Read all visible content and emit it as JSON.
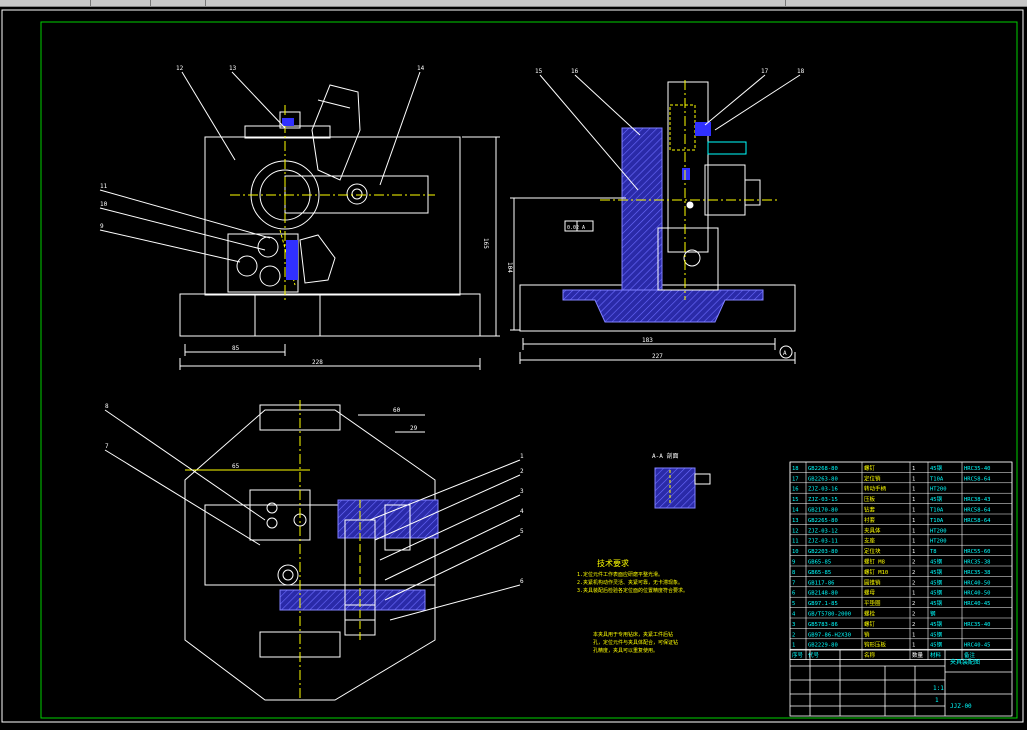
{
  "toolbar": {
    "tabs": [
      "",
      "",
      "",
      "",
      ""
    ]
  },
  "drawing": {
    "section_label": "A-A 剖面",
    "tech_title": "技术要求",
    "tech_notes": [
      "1.定位元件工作表面应研磨平整光滑。",
      "2.夹紧机构动作灵活、夹紧可靠，无卡滞现象。",
      "3.夹具装配后检验各定位面的位置精度符合要求。"
    ],
    "note_body": [
      "本夹具用于专用钻床，夹紧工件后钻",
      "孔，定位元件与夹具体配合，可保证钻",
      "孔精度，夹具可以重复使用。"
    ],
    "dimensions": {
      "w_front": "228",
      "w_front_part": "85",
      "h_front": "165",
      "w_side": "227",
      "w_side_part": "183",
      "h_side": "104",
      "top_view_1": "65",
      "top_view_2": "60",
      "top_view_3": "29",
      "tol_frame": "0.02 A",
      "datum": "A"
    },
    "balloons": [
      "1",
      "2",
      "3",
      "4",
      "5",
      "6",
      "7",
      "8",
      "9",
      "10",
      "11",
      "12",
      "13",
      "14",
      "15",
      "16",
      "17",
      "18"
    ],
    "title_block": {
      "title": "夹具装配图",
      "drawing_no": "JJZ-00",
      "scale": "1:1",
      "sheet": "1"
    },
    "bom": [
      [
        "18",
        "GB2268-80",
        "螺钉",
        "1",
        "45钢",
        "HRC35-40"
      ],
      [
        "17",
        "GB2263-80",
        "定位销",
        "1",
        "T10A",
        "HRC58-64"
      ],
      [
        "16",
        "ZJZ-03-16",
        "转动手柄",
        "1",
        "HT200",
        ""
      ],
      [
        "15",
        "ZJZ-03-15",
        "压板",
        "1",
        "45钢",
        "HRC38-43"
      ],
      [
        "14",
        "GB2170-80",
        "钻套",
        "1",
        "T10A",
        "HRC58-64"
      ],
      [
        "13",
        "GB2265-80",
        "衬套",
        "1",
        "T10A",
        "HRC58-64"
      ],
      [
        "12",
        "ZJZ-03-12",
        "夹具体",
        "1",
        "HT200",
        ""
      ],
      [
        "11",
        "ZJZ-03-11",
        "支座",
        "1",
        "HT200",
        ""
      ],
      [
        "10",
        "GB2203-80",
        "定位块",
        "1",
        "T8",
        "HRC55-60"
      ],
      [
        "9",
        "GB65-85",
        "螺钉 M8",
        "2",
        "45钢",
        "HRC35-38"
      ],
      [
        "8",
        "GB65-85",
        "螺钉 M10",
        "2",
        "45钢",
        "HRC35-38"
      ],
      [
        "7",
        "GB117-86",
        "圆锥销",
        "2",
        "45钢",
        "HRC40-50"
      ],
      [
        "6",
        "GB2148-80",
        "螺母",
        "1",
        "45钢",
        "HRC40-50"
      ],
      [
        "5",
        "GB97.1-85",
        "平垫圈",
        "2",
        "45钢",
        "HRC40-45"
      ],
      [
        "4",
        "GB/T5780-2000",
        "螺栓",
        "2",
        "钢",
        ""
      ],
      [
        "3",
        "GB5783-86",
        "螺钉",
        "2",
        "45钢",
        "HRC35-40"
      ],
      [
        "2",
        "GB97-86-H2X30",
        "销",
        "1",
        "45钢",
        ""
      ],
      [
        "1",
        "GB2229-80",
        "钩形压板",
        "1",
        "45钢",
        "HRC40-45"
      ]
    ],
    "bom_header": [
      "序号",
      "代号",
      "名称",
      "数量",
      "材料",
      "备注"
    ]
  }
}
